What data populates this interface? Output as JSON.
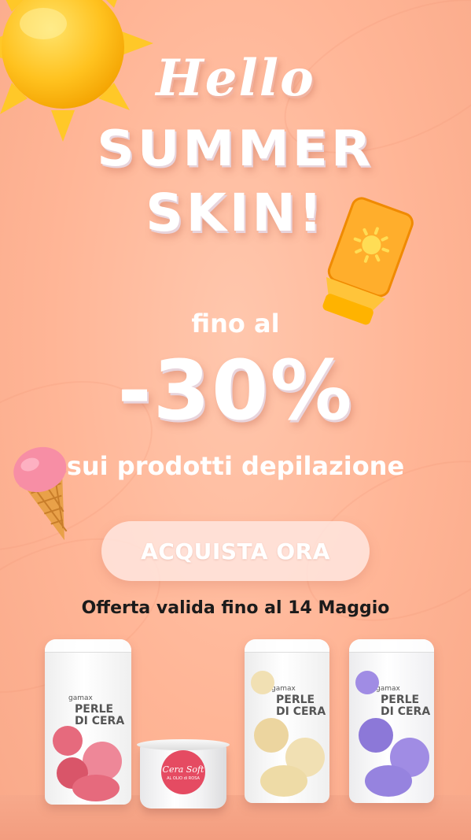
{
  "banner": {
    "hello": "Hello",
    "line1": "SUMMER",
    "line2": "SKIN!",
    "fino": "fino al",
    "discount": "-30%",
    "sub_highlight": "sui",
    "sub_rest": " prodotti depilazione",
    "cta_label": "ACQUISTA ORA",
    "validity": "Offerta valida fino al 14 Maggio"
  },
  "products": [
    {
      "brand": "gamax",
      "title_line1": "PERLE",
      "title_line2": "DI CERA",
      "bead_color": "#e66a7d"
    },
    {
      "label_title": "Cera Soft",
      "label_sub": "AL OLIO di ROSA"
    },
    {
      "brand": "gamax",
      "title_line1": "PERLE",
      "title_line2": "DI CERA",
      "bead_color": "#f1e0b3"
    },
    {
      "brand": "gamax",
      "title_line1": "PERLE",
      "title_line2": "DI CERA",
      "bead_color": "#a08ce4"
    }
  ],
  "colors": {
    "background": "#ffb596",
    "text": "#ffffff",
    "validity_text": "#1b1b1b",
    "accent_jar": "#e54b62"
  }
}
